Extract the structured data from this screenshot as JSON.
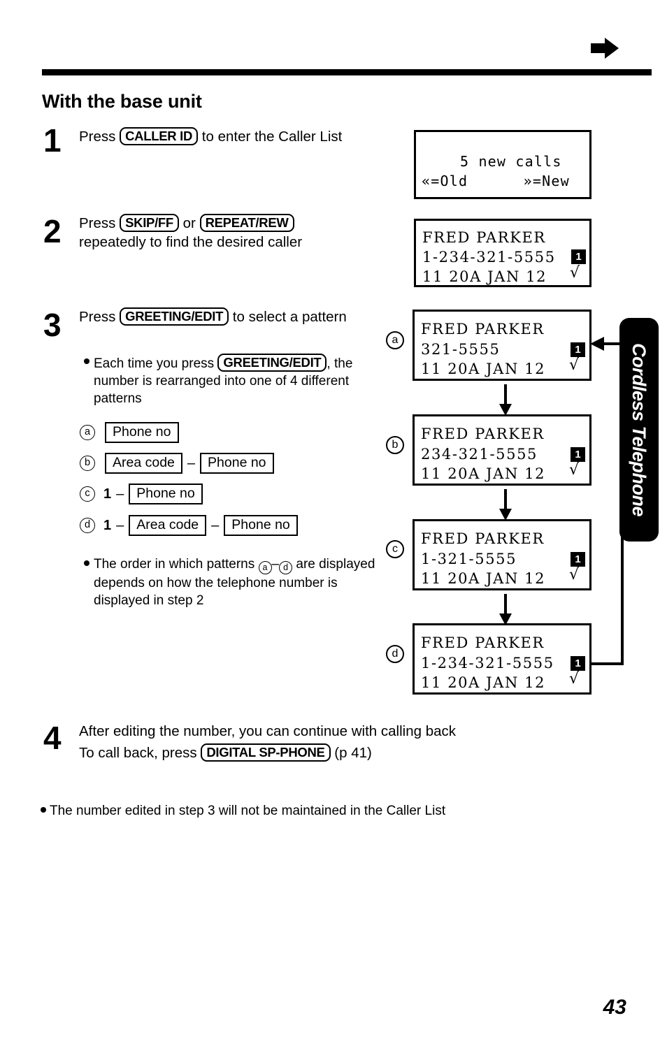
{
  "header": {
    "arrow_icon": "right-arrow-icon",
    "rule": true
  },
  "section_title": "With the base unit",
  "steps": [
    {
      "number": "1",
      "text_before": "Press ",
      "key": "CALLER ID",
      "text_after": " to enter the Caller List"
    },
    {
      "number": "2",
      "text_before": "Press ",
      "key": "SKIP/FF",
      "text_middle": " or ",
      "key2": "REPEAT/REW",
      "text_after": "repeatedly to find the desired caller"
    },
    {
      "number": "3",
      "text_before": "Press ",
      "key": "GREETING/EDIT",
      "text_after": " to select a pattern"
    },
    {
      "number": "4",
      "line1": "After editing the number, you can continue with calling back",
      "line2_before": "To call back, press ",
      "key": "DIGITAL SP-PHONE",
      "line2_after": " (p  41)"
    }
  ],
  "bullets": {
    "each_time_before": "Each time you press ",
    "each_time_key": "GREETING/EDIT",
    "each_time_after": ", the number is rearranged into one of 4 different patterns",
    "order_note_1": "The order in which patterns ",
    "order_note_a": "a",
    "order_note_dash": "–",
    "order_note_d": "d",
    "order_note_2": " are displayed depends on how the telephone number is displayed in step 2",
    "final_note": "The number edited in step 3 will not be maintained in the Caller List"
  },
  "patterns": [
    {
      "mark": "a",
      "prefix": "",
      "boxes": [
        "Phone no"
      ]
    },
    {
      "mark": "b",
      "prefix": "",
      "boxes": [
        "Area code",
        "Phone no"
      ]
    },
    {
      "mark": "c",
      "prefix": "1",
      "boxes": [
        "Phone no"
      ]
    },
    {
      "mark": "d",
      "prefix": "1",
      "boxes": [
        "Area code",
        "Phone no"
      ]
    }
  ],
  "pattern_labels": {
    "phone_no": "Phone no",
    "area_code": "Area code",
    "one": "1",
    "dash": "–"
  },
  "lcd_panels": [
    {
      "id": "intro",
      "mark": "",
      "line1": "    5 new calls",
      "line2": "«=Old      »=New",
      "line3": "",
      "badge": "",
      "check": ""
    },
    {
      "id": "step2",
      "mark": "",
      "line1": "FRED PARKER",
      "line2": "1-234-321-5555",
      "line3": "11 20A JAN 12",
      "badge": "1",
      "check": "√"
    },
    {
      "id": "a",
      "mark": "a",
      "line1": "FRED PARKER",
      "line2": "321-5555",
      "line3": "11 20A JAN 12",
      "badge": "1",
      "check": "√"
    },
    {
      "id": "b",
      "mark": "b",
      "line1": "FRED PARKER",
      "line2": "234-321-5555",
      "line3": "11 20A JAN 12",
      "badge": "1",
      "check": "√"
    },
    {
      "id": "c",
      "mark": "c",
      "line1": "FRED PARKER",
      "line2": "1-321-5555",
      "line3": "11 20A JAN 12",
      "badge": "1",
      "check": "√"
    },
    {
      "id": "d",
      "mark": "d",
      "line1": "FRED PARKER",
      "line2": "1-234-321-5555",
      "line3": "11 20A JAN 12",
      "badge": "1",
      "check": "√"
    }
  ],
  "side_tab": {
    "label": "Cordless Telephone"
  },
  "page_number": "43",
  "colors": {
    "ink": "#000000",
    "paper": "#ffffff"
  }
}
